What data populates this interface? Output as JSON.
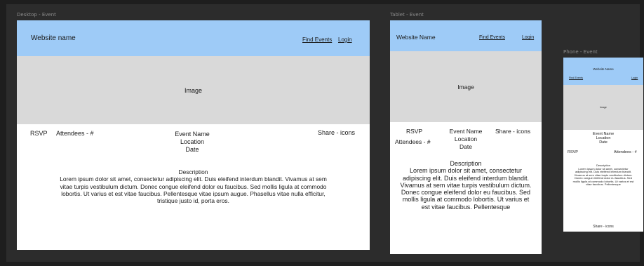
{
  "desktop": {
    "frame_label": "Desktop - Event",
    "site_name": "Website name",
    "nav": {
      "find_events": "Find Events",
      "login": "Login"
    },
    "image_label": "Image",
    "rsvp": "RSVP",
    "attendees": "Attendees - #",
    "event_name": "Event Name",
    "location": "Location",
    "date": "Date",
    "share": "Share - icons",
    "description_title": "Description",
    "description_body": "Lorem ipsum dolor sit amet, consectetur adipiscing elit. Duis eleifend interdum blandit. Vivamus at sem vitae turpis vestibulum dictum. Donec congue eleifend dolor eu faucibus. Sed mollis ligula at commodo lobortis. Ut varius et est vitae faucibus. Pellentesque vitae ipsum augue. Phasellus vitae nulla efficitur, tristique justo id, porta eros."
  },
  "tablet": {
    "frame_label": "Tablet - Event",
    "site_name": "Website Name",
    "nav": {
      "find_events": "Find Events",
      "login": "Login"
    },
    "image_label": "Image",
    "rsvp": "RSVP",
    "attendees": "Attendees - #",
    "event_name": "Event Name",
    "location": "Location",
    "date": "Date",
    "share": "Share - icons",
    "description_title": "Description",
    "description_body": "Lorem ipsum dolor sit amet, consectetur adipiscing elit. Duis eleifend interdum blandit. Vivamus at sem vitae turpis vestibulum dictum. Donec congue eleifend dolor eu faucibus. Sed mollis ligula at commodo lobortis. Ut varius et est vitae faucibus. Pellentesque"
  },
  "phone": {
    "frame_label": "Phone - Event",
    "site_name": "Website Name",
    "nav": {
      "find_events": "Find Events",
      "login": "Login"
    },
    "image_label": "Image",
    "event_name": "Event Name",
    "location": "Location",
    "date": "Date",
    "rsvp": "RSVP",
    "attendees": "Attendees - #",
    "description_title": "Description",
    "description_body": "Lorem ipsum dolor sit amet, consectetur adipiscing elit. Duis eleifend interdum blandit. Vivamus at sem vitae turpis vestibulum dictum. Donec congue eleifend dolor eu faucibus. Sed mollis ligula at commodo lobortis. Ut varius et est vitae faucibus. Pellentesque",
    "share": "Share - icons"
  },
  "colors": {
    "header": "#9ecbf7",
    "image_placeholder": "#d9d9d9",
    "canvas": "#2c2c2c",
    "frame": "#ffffff"
  }
}
